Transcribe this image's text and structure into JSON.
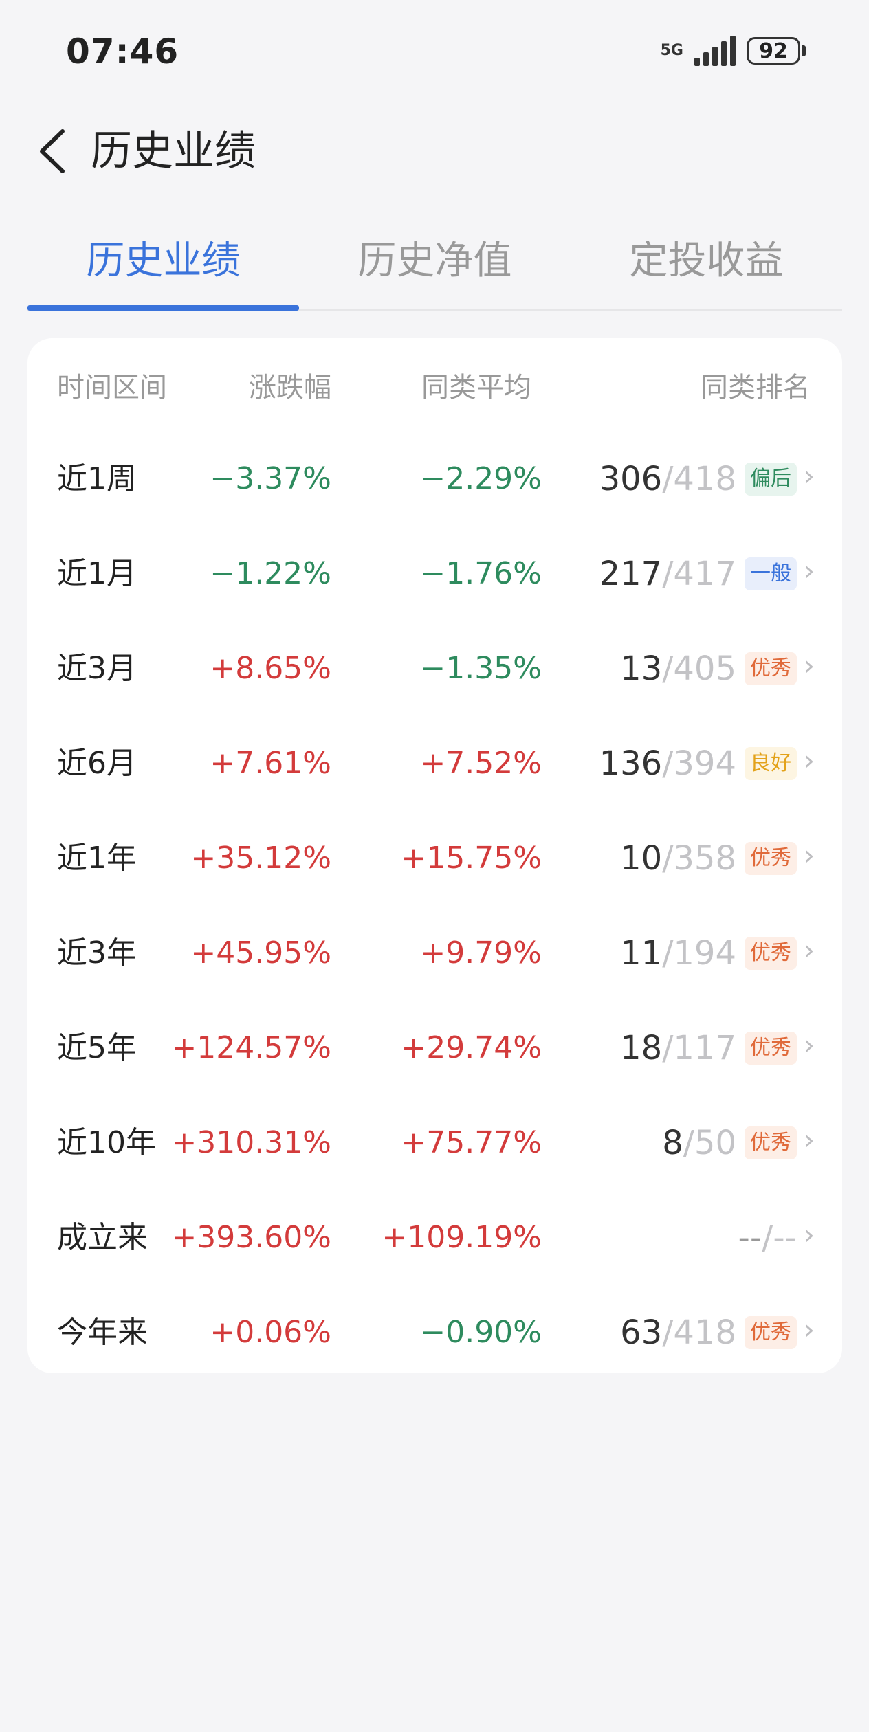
{
  "status": {
    "time": "07:46",
    "network": "5G",
    "battery": "92"
  },
  "header": {
    "title": "历史业绩"
  },
  "tabs": [
    {
      "label": "历史业绩",
      "active": true
    },
    {
      "label": "历史净值",
      "active": false
    },
    {
      "label": "定投收益",
      "active": false
    }
  ],
  "table": {
    "headers": {
      "period": "时间区间",
      "change": "涨跌幅",
      "avg": "同类平均",
      "rank": "同类排名"
    },
    "rows": [
      {
        "period": "近1周",
        "change": "−3.37%",
        "change_dir": "down",
        "avg": "−2.29%",
        "avg_dir": "down",
        "rank": "306",
        "total": "/418",
        "badge": "偏后",
        "badge_color": "#2e8b5e",
        "badge_bg": "#e7f4ee"
      },
      {
        "period": "近1月",
        "change": "−1.22%",
        "change_dir": "down",
        "avg": "−1.76%",
        "avg_dir": "down",
        "rank": "217",
        "total": "/417",
        "badge": "一般",
        "badge_color": "#3a73db",
        "badge_bg": "#e8eefb"
      },
      {
        "period": "近3月",
        "change": "+8.65%",
        "change_dir": "up",
        "avg": "−1.35%",
        "avg_dir": "down",
        "rank": "13",
        "total": "/405",
        "badge": "优秀",
        "badge_color": "#e06a3a",
        "badge_bg": "#fdeee6"
      },
      {
        "period": "近6月",
        "change": "+7.61%",
        "change_dir": "up",
        "avg": "+7.52%",
        "avg_dir": "up",
        "rank": "136",
        "total": "/394",
        "badge": "良好",
        "badge_color": "#e3a21a",
        "badge_bg": "#fdf5e2"
      },
      {
        "period": "近1年",
        "change": "+35.12%",
        "change_dir": "up",
        "avg": "+15.75%",
        "avg_dir": "up",
        "rank": "10",
        "total": "/358",
        "badge": "优秀",
        "badge_color": "#e06a3a",
        "badge_bg": "#fdeee6"
      },
      {
        "period": "近3年",
        "change": "+45.95%",
        "change_dir": "up",
        "avg": "+9.79%",
        "avg_dir": "up",
        "rank": "11",
        "total": "/194",
        "badge": "优秀",
        "badge_color": "#e06a3a",
        "badge_bg": "#fdeee6"
      },
      {
        "period": "近5年",
        "change": "+124.57%",
        "change_dir": "up",
        "avg": "+29.74%",
        "avg_dir": "up",
        "rank": "18",
        "total": "/117",
        "badge": "优秀",
        "badge_color": "#e06a3a",
        "badge_bg": "#fdeee6"
      },
      {
        "period": "近10年",
        "change": "+310.31%",
        "change_dir": "up",
        "avg": "+75.77%",
        "avg_dir": "up",
        "rank": "8",
        "total": "/50",
        "badge": "优秀",
        "badge_color": "#e06a3a",
        "badge_bg": "#fdeee6"
      },
      {
        "period": "成立来",
        "change": "+393.60%",
        "change_dir": "up",
        "avg": "+109.19%",
        "avg_dir": "up",
        "rank": "--",
        "total": "/--",
        "badge": "",
        "badge_color": "#999999",
        "badge_bg": "transparent"
      },
      {
        "period": "今年来",
        "change": "+0.06%",
        "change_dir": "up",
        "avg": "−0.90%",
        "avg_dir": "down",
        "rank": "63",
        "total": "/418",
        "badge": "优秀",
        "badge_color": "#e06a3a",
        "badge_bg": "#fdeee6"
      }
    ]
  }
}
